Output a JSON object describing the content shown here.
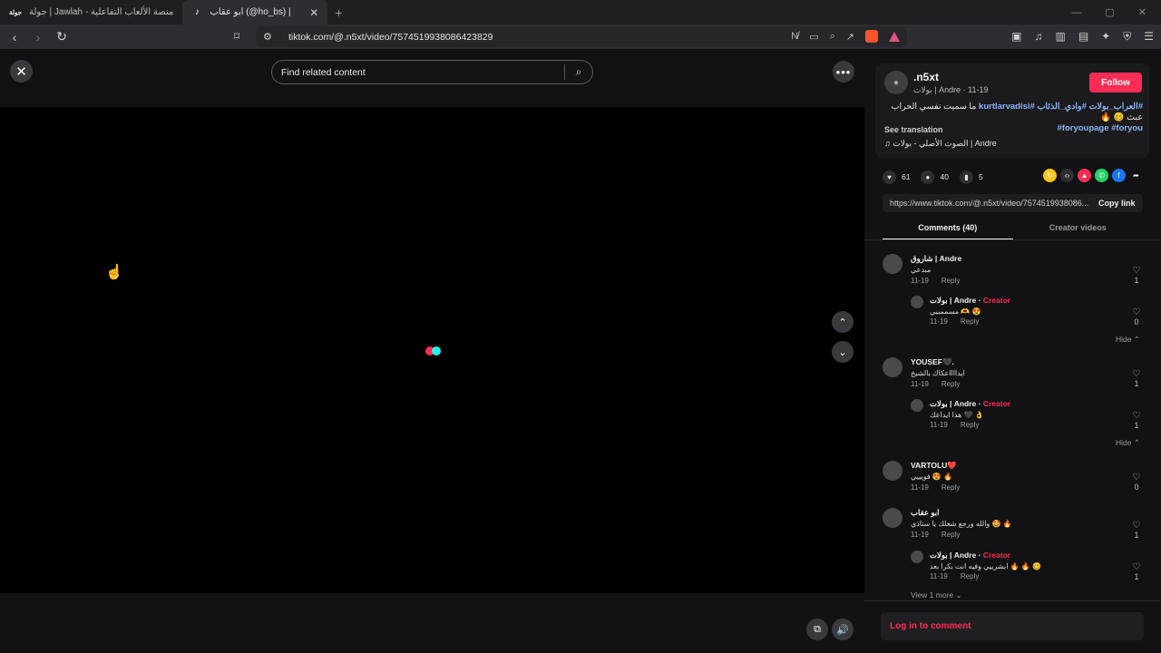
{
  "browser": {
    "tabs": [
      {
        "title": "جولة | Jawlah - منصة الألعاب التفاعلية",
        "icon": "جولة-favicon",
        "icon_text": "جولة",
        "active": false
      },
      {
        "title": "ابو عقاب (@ho_bs) | TikTok",
        "icon": "tiktok-icon",
        "active": true
      }
    ],
    "new_tab": "+",
    "url": "tiktok.com/@.n5xt/video/7574519938086423829"
  },
  "video": {
    "search_placeholder": "Find related content"
  },
  "post": {
    "author": ".n5xt",
    "author_sub": "بولات | Andre · 11-19",
    "follow_label": "Follow",
    "caption_text": "ما سميت نفسي الحراب عبث 🥴 🔥",
    "caption_tags_1": "#العراب_بولات #وادي_الذئاب #kurtlarvadisi",
    "caption_tags_2": "#foryoupage #foryou",
    "see_translation": "See translation",
    "music": "الصوت الأصلي - بولات | Andre",
    "likes": "61",
    "comments": "40",
    "saves": "5",
    "link": "https://www.tiktok.com/@.n5xt/video/7574519938086...",
    "copy_link": "Copy link",
    "tab_comments": "Comments (40)",
    "tab_creator": "Creator videos"
  },
  "comments": [
    {
      "name": "شاروق | Andre",
      "text": "مبدعي",
      "date": "11-19",
      "reply": "Reply",
      "likes": "1"
    },
    {
      "name": "بولات | Andre",
      "creator": "Creator",
      "text": "مسممبيي 🫶 😍",
      "date": "11-19",
      "reply": "Reply",
      "likes": "0"
    },
    {
      "name": "YOUSEF🖤.",
      "text": "ايدااااعكاك بالشيخ",
      "date": "11-19",
      "reply": "Reply",
      "likes": "1"
    },
    {
      "name": "بولات | Andre",
      "creator": "Creator",
      "text": "هذا ايداعك 🖤 👌",
      "date": "11-19",
      "reply": "Reply",
      "likes": "1"
    },
    {
      "name": "VARTOLU❤️",
      "text": "فويييي 😍 🔥",
      "date": "11-19",
      "reply": "Reply",
      "likes": "0"
    },
    {
      "name": "ابو عقاب",
      "text": "والله ورجع شغلك يا ستاذي 🤩 🔥",
      "date": "11-19",
      "reply": "Reply",
      "likes": "1"
    },
    {
      "name": "بولات | Andre",
      "creator": "Creator",
      "text": "ابشرييي وفيه انت بكرا بعد 🔥 🔥 🥴",
      "date": "11-19",
      "reply": "Reply",
      "likes": "1"
    }
  ],
  "hide_label": "Hide",
  "view_more": "View 1 more",
  "login_label": "Log in to comment",
  "colors": {
    "accent": "#fe2c55",
    "cyan": "#25f4ee",
    "panel_bg": "#121214"
  }
}
